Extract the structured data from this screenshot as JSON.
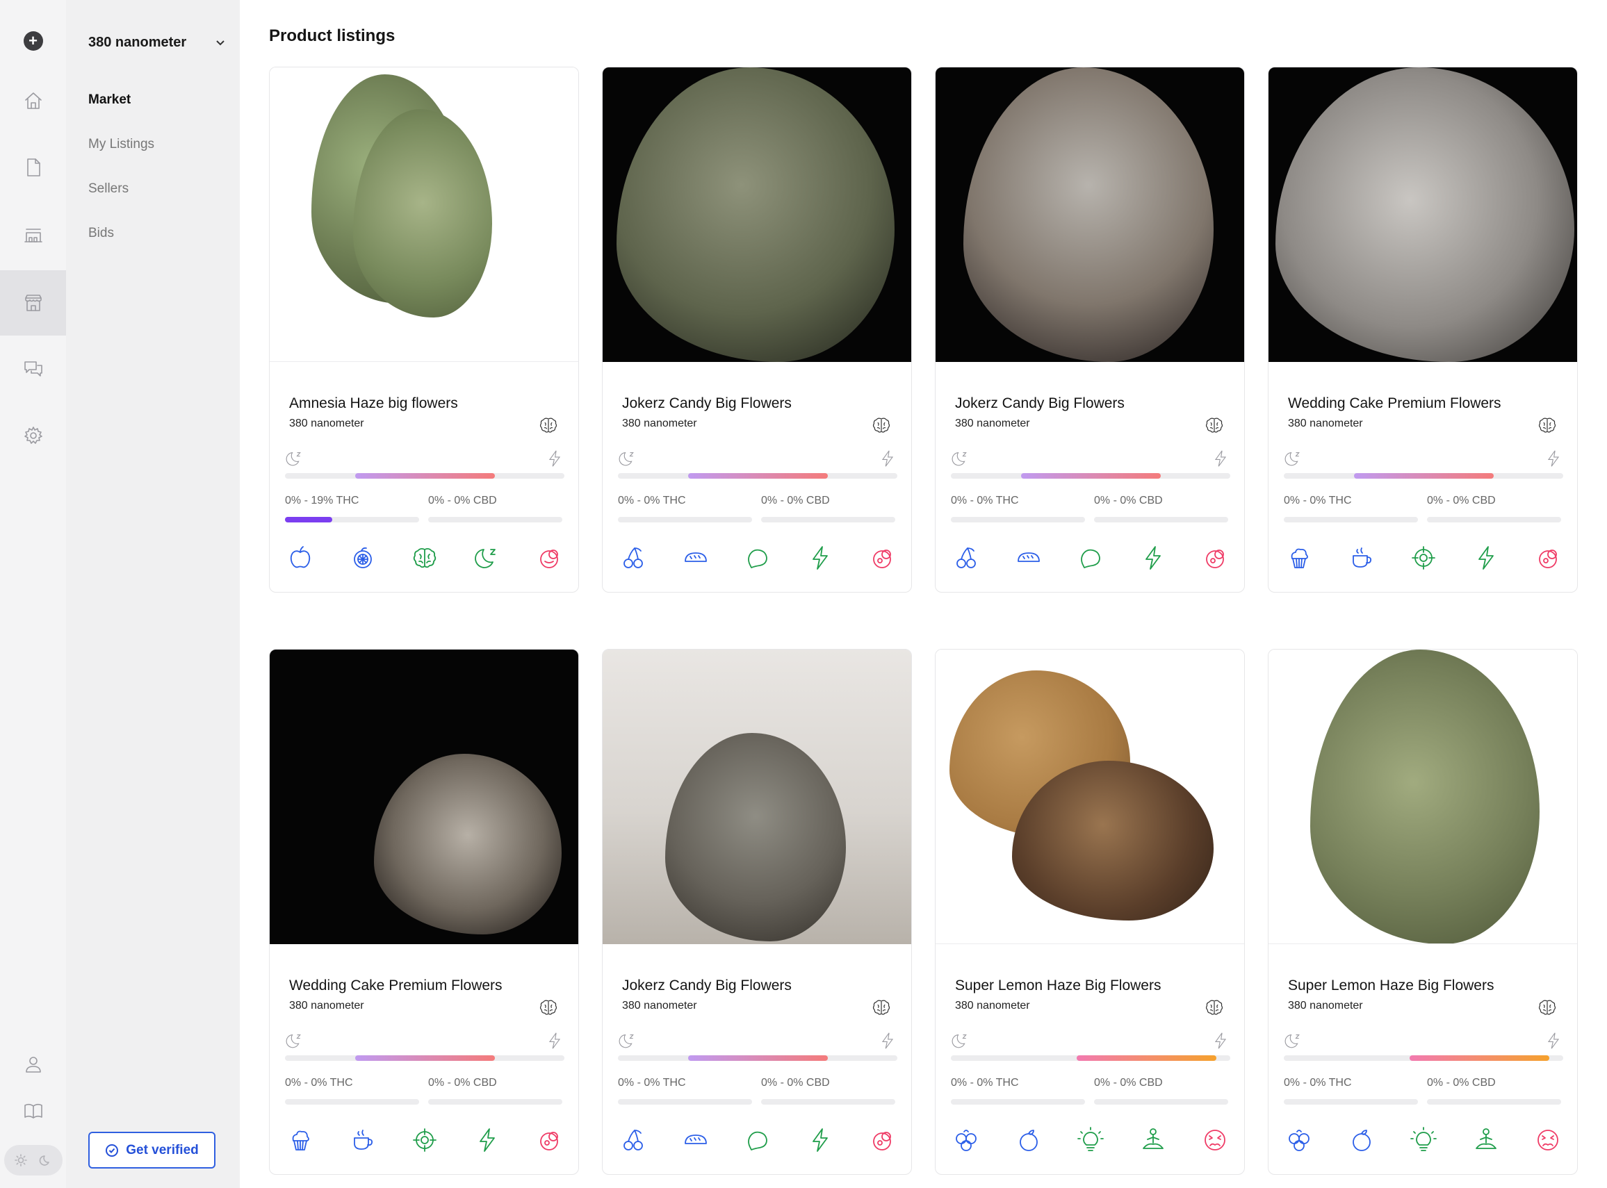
{
  "workspace": {
    "name": "380 nanometer"
  },
  "nav": [
    {
      "label": "Market"
    },
    {
      "label": "My Listings"
    },
    {
      "label": "Sellers"
    },
    {
      "label": "Bids"
    }
  ],
  "verify_label": "Get verified",
  "page_title": "Product listings",
  "colors": {
    "accent_blue": "#2b5ee8",
    "accent_green": "#1f9d4a",
    "accent_red": "#ef3b66",
    "thc_fill": "#7b3ef0"
  },
  "products": [
    {
      "title": "Amnesia Haze big flowers",
      "seller": "380 nanometer",
      "thc": "0% - 19% THC",
      "cbd": "0% - 0% CBD",
      "thc_fraction": 0.35,
      "cbd_fraction": 0,
      "spectrum": {
        "from": 0.25,
        "to": 0.75,
        "gradient": [
          "#c09af0",
          "#f47b7b"
        ]
      },
      "traits": [
        {
          "icon": "apple-icon",
          "color": "blue"
        },
        {
          "icon": "citrus-icon",
          "color": "blue"
        },
        {
          "icon": "brain-icon",
          "color": "green"
        },
        {
          "icon": "sleepy-moon-icon",
          "color": "green"
        },
        {
          "icon": "dry-mouth-icon",
          "color": "red"
        }
      ]
    },
    {
      "title": "Jokerz Candy Big Flowers",
      "seller": "380 nanometer",
      "thc": "0% - 0% THC",
      "cbd": "0% - 0% CBD",
      "thc_fraction": 0,
      "cbd_fraction": 0,
      "spectrum": {
        "from": 0.25,
        "to": 0.75,
        "gradient": [
          "#c09af0",
          "#f47b7b"
        ]
      },
      "traits": [
        {
          "icon": "cherry-icon",
          "color": "blue"
        },
        {
          "icon": "bread-icon",
          "color": "blue"
        },
        {
          "icon": "talk-bubble-icon",
          "color": "green"
        },
        {
          "icon": "energy-bolt-icon",
          "color": "green"
        },
        {
          "icon": "dry-eyes-icon",
          "color": "red"
        }
      ]
    },
    {
      "title": "Jokerz Candy Big Flowers",
      "seller": "380 nanometer",
      "thc": "0% - 0% THC",
      "cbd": "0% - 0% CBD",
      "thc_fraction": 0,
      "cbd_fraction": 0,
      "spectrum": {
        "from": 0.25,
        "to": 0.75,
        "gradient": [
          "#c09af0",
          "#f47b7b"
        ]
      },
      "traits": [
        {
          "icon": "cherry-icon",
          "color": "blue"
        },
        {
          "icon": "bread-icon",
          "color": "blue"
        },
        {
          "icon": "talk-bubble-icon",
          "color": "green"
        },
        {
          "icon": "energy-bolt-icon",
          "color": "green"
        },
        {
          "icon": "dry-eyes-icon",
          "color": "red"
        }
      ]
    },
    {
      "title": "Wedding Cake Premium Flowers",
      "seller": "380 nanometer",
      "thc": "0% - 0% THC",
      "cbd": "0% - 0% CBD",
      "thc_fraction": 0,
      "cbd_fraction": 0,
      "spectrum": {
        "from": 0.25,
        "to": 0.75,
        "gradient": [
          "#c09af0",
          "#f47b7b"
        ]
      },
      "traits": [
        {
          "icon": "cupcake-icon",
          "color": "blue"
        },
        {
          "icon": "coffee-icon",
          "color": "blue"
        },
        {
          "icon": "target-icon",
          "color": "green"
        },
        {
          "icon": "energy-bolt-icon",
          "color": "green"
        },
        {
          "icon": "dry-eyes-icon",
          "color": "red"
        }
      ]
    },
    {
      "title": "Wedding Cake Premium Flowers",
      "seller": "380 nanometer",
      "thc": "0% - 0% THC",
      "cbd": "0% - 0% CBD",
      "thc_fraction": 0,
      "cbd_fraction": 0,
      "spectrum": {
        "from": 0.25,
        "to": 0.75,
        "gradient": [
          "#c09af0",
          "#f47b7b"
        ]
      },
      "traits": [
        {
          "icon": "cupcake-icon",
          "color": "blue"
        },
        {
          "icon": "coffee-icon",
          "color": "blue"
        },
        {
          "icon": "target-icon",
          "color": "green"
        },
        {
          "icon": "energy-bolt-icon",
          "color": "green"
        },
        {
          "icon": "dry-eyes-icon",
          "color": "red"
        }
      ]
    },
    {
      "title": "Jokerz Candy Big Flowers",
      "seller": "380 nanometer",
      "thc": "0% - 0% THC",
      "cbd": "0% - 0% CBD",
      "thc_fraction": 0,
      "cbd_fraction": 0,
      "spectrum": {
        "from": 0.25,
        "to": 0.75,
        "gradient": [
          "#c09af0",
          "#f47b7b"
        ]
      },
      "traits": [
        {
          "icon": "cherry-icon",
          "color": "blue"
        },
        {
          "icon": "bread-icon",
          "color": "blue"
        },
        {
          "icon": "talk-bubble-icon",
          "color": "green"
        },
        {
          "icon": "energy-bolt-icon",
          "color": "green"
        },
        {
          "icon": "dry-eyes-icon",
          "color": "red"
        }
      ]
    },
    {
      "title": "Super Lemon Haze Big Flowers",
      "seller": "380 nanometer",
      "thc": "0% - 0% THC",
      "cbd": "0% - 0% CBD",
      "thc_fraction": 0,
      "cbd_fraction": 0,
      "spectrum": {
        "from": 0.45,
        "to": 0.95,
        "gradient": [
          "#f27ab0",
          "#f5a12d"
        ]
      },
      "traits": [
        {
          "icon": "berries-icon",
          "color": "blue"
        },
        {
          "icon": "orange-icon",
          "color": "blue"
        },
        {
          "icon": "lightbulb-icon",
          "color": "green"
        },
        {
          "icon": "meditation-icon",
          "color": "green"
        },
        {
          "icon": "anxious-face-icon",
          "color": "red"
        }
      ]
    },
    {
      "title": "Super Lemon Haze Big Flowers",
      "seller": "380 nanometer",
      "thc": "0% - 0% THC",
      "cbd": "0% - 0% CBD",
      "thc_fraction": 0,
      "cbd_fraction": 0,
      "spectrum": {
        "from": 0.45,
        "to": 0.95,
        "gradient": [
          "#f27ab0",
          "#f5a12d"
        ]
      },
      "traits": [
        {
          "icon": "berries-icon",
          "color": "blue"
        },
        {
          "icon": "orange-icon",
          "color": "blue"
        },
        {
          "icon": "lightbulb-icon",
          "color": "green"
        },
        {
          "icon": "meditation-icon",
          "color": "green"
        },
        {
          "icon": "anxious-face-icon",
          "color": "red"
        }
      ]
    }
  ]
}
